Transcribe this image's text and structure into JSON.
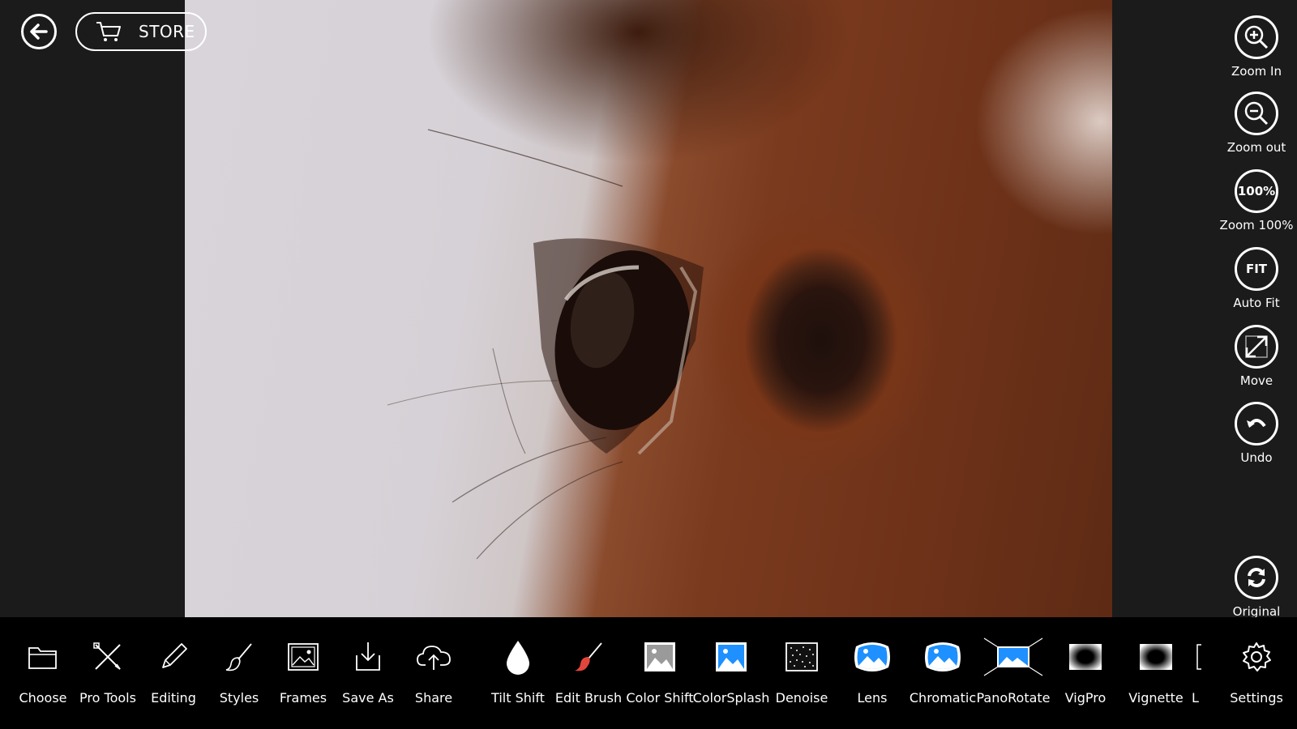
{
  "header": {
    "back_icon": "back-arrow-icon",
    "store_label": "STORE",
    "store_icon": "cart-icon"
  },
  "right_rail": {
    "zoom_in": "Zoom In",
    "zoom_out": "Zoom out",
    "zoom_100": "Zoom 100%",
    "zoom_100_badge": "100%",
    "auto_fit": "Auto Fit",
    "auto_fit_badge": "FIT",
    "move": "Move",
    "undo": "Undo",
    "original": "Original"
  },
  "toolbar": {
    "choose": "Choose",
    "pro_tools": "Pro Tools",
    "editing": "Editing",
    "styles": "Styles",
    "frames": "Frames",
    "save_as": "Save As",
    "share": "Share",
    "tilt_shift": "Tilt Shift",
    "edit_brush": "Edit Brush",
    "color_shift": "Color Shift",
    "color_splash": "ColorSplash",
    "denoise": "Denoise",
    "lens": "Lens",
    "chromatic": "Chromatic",
    "pano_rotate": "PanoRotate",
    "vigpro": "VigPro",
    "vignette": "Vignette",
    "overflow": "L",
    "settings": "Settings"
  },
  "colors": {
    "background": "#1b1b1b",
    "toolbar": "#000000",
    "accent_blue": "#1e90ff",
    "brush_red": "#e0463c"
  }
}
